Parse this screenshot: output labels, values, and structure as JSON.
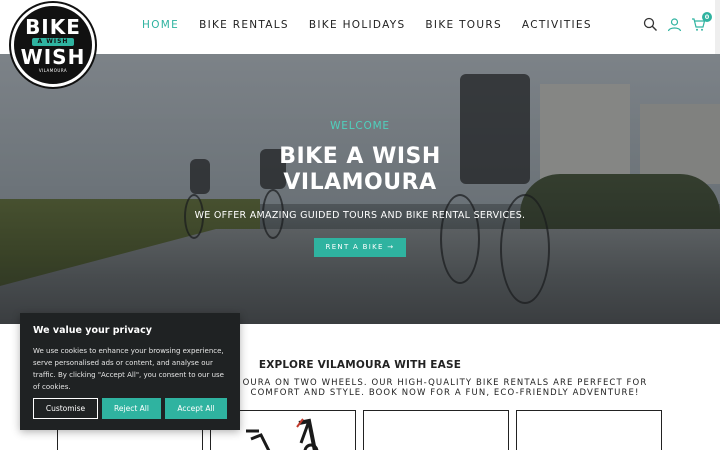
{
  "header": {
    "logo": {
      "line1": "BIKE",
      "line2": "A WISH",
      "line3": "WISH",
      "line4": "VILAMOURA"
    },
    "nav": [
      {
        "label": "HOME",
        "active": true
      },
      {
        "label": "BIKE RENTALS",
        "active": false
      },
      {
        "label": "BIKE HOLIDAYS",
        "active": false
      },
      {
        "label": "BIKE TOURS",
        "active": false
      },
      {
        "label": "ACTIVITIES",
        "active": false
      }
    ],
    "icons": [
      "search-icon",
      "user-icon",
      "cart-icon"
    ],
    "cart_count": "0"
  },
  "hero": {
    "welcome": "WELCOME",
    "title_line1": "BIKE A WISH",
    "title_line2": "VILAMOURA",
    "subtitle": "WE OFFER AMAZING GUIDED TOURS AND BIKE RENTAL SERVICES.",
    "cta_label": "RENT A BIKE →"
  },
  "explore": {
    "title": "EXPLORE VILAMOURA WITH EASE",
    "desc_line1": "OURA ON TWO WHEELS. OUR HIGH-QUALITY BIKE RENTALS ARE PERFECT FOR",
    "desc_line2": "COMFORT AND STYLE. BOOK NOW FOR A FUN, ECO-FRIENDLY ADVENTURE!"
  },
  "cookie": {
    "title": "We value your privacy",
    "text": "We use cookies to enhance your browsing experience, serve personalised ads or content, and analyse our traffic. By clicking \"Accept All\", you consent to our use of cookies.",
    "customise_label": "Customise",
    "reject_label": "Reject All",
    "accept_label": "Accept All"
  },
  "colors": {
    "accent": "#2fb3a0",
    "dark": "#1f2223"
  }
}
